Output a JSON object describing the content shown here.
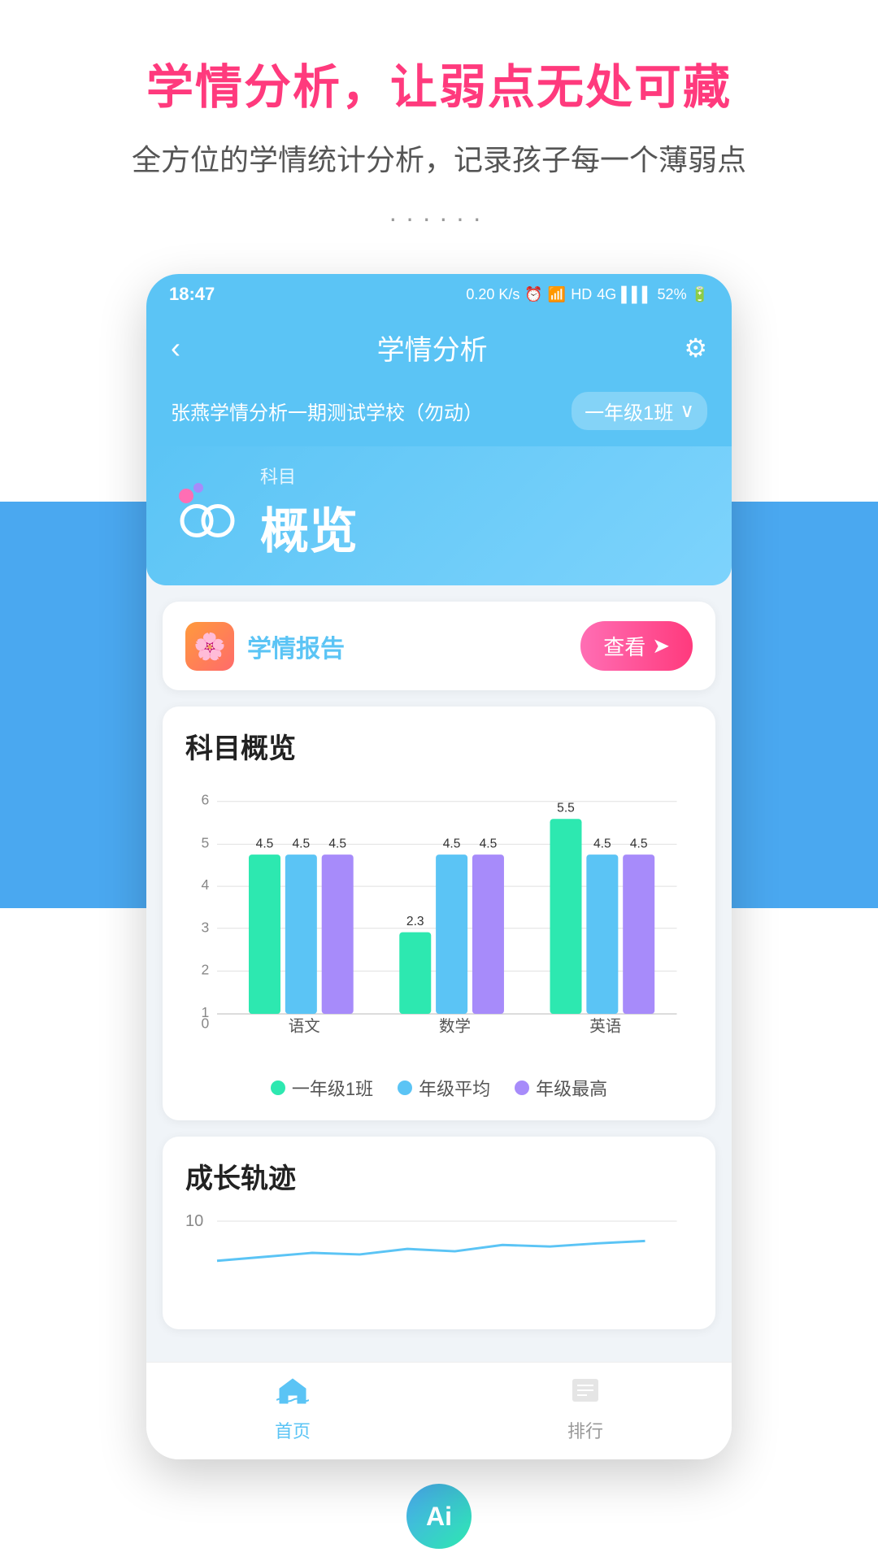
{
  "page": {
    "title": "学情分析，让弱点无处可藏",
    "subtitle": "全方位的学情统计分析，记录孩子每一个薄弱点",
    "dots": "······"
  },
  "statusBar": {
    "time": "18:47",
    "rightIcons": "0.20 K/s  ⏰  📶  HD  4G  52%"
  },
  "navBar": {
    "backIcon": "‹",
    "title": "学情分析",
    "settingsIcon": "⚙"
  },
  "schoolBar": {
    "schoolName": "张燕学情分析一期测试学校（勿动）",
    "classSelector": "一年级1班",
    "dropdownIcon": "∨"
  },
  "subjectCard": {
    "labelSmall": "科目",
    "labelBig": "概览"
  },
  "reportCard": {
    "title": "学情报告",
    "viewButton": "查看",
    "viewIcon": "⊙"
  },
  "subjectOverview": {
    "sectionTitle": "科目概览",
    "yAxisMax": 6,
    "yAxisLabels": [
      "0",
      "2",
      "4",
      "6"
    ],
    "xAxisLabels": [
      "语文",
      "数学",
      "英语"
    ],
    "bars": [
      {
        "subject": "语文",
        "class1": 4.5,
        "gradeAvg": 4.5,
        "gradeMax": 4.5
      },
      {
        "subject": "数学",
        "class1": 2.3,
        "gradeAvg": 4.5,
        "gradeMax": 4.5
      },
      {
        "subject": "英语",
        "class1": 5.5,
        "gradeAvg": 4.5,
        "gradeMax": 4.5
      }
    ],
    "legend": [
      {
        "label": "一年级1班",
        "color": "#2de8b0"
      },
      {
        "label": "年级平均",
        "color": "#5bc4f5"
      },
      {
        "label": "年级最高",
        "color": "#a78bfa"
      }
    ]
  },
  "growthSection": {
    "sectionTitle": "成长轨迹",
    "yAxisMax": 10
  },
  "bottomNav": {
    "items": [
      {
        "label": "首页",
        "icon": "home",
        "active": true
      },
      {
        "label": "排行",
        "icon": "rank",
        "active": false
      }
    ]
  }
}
